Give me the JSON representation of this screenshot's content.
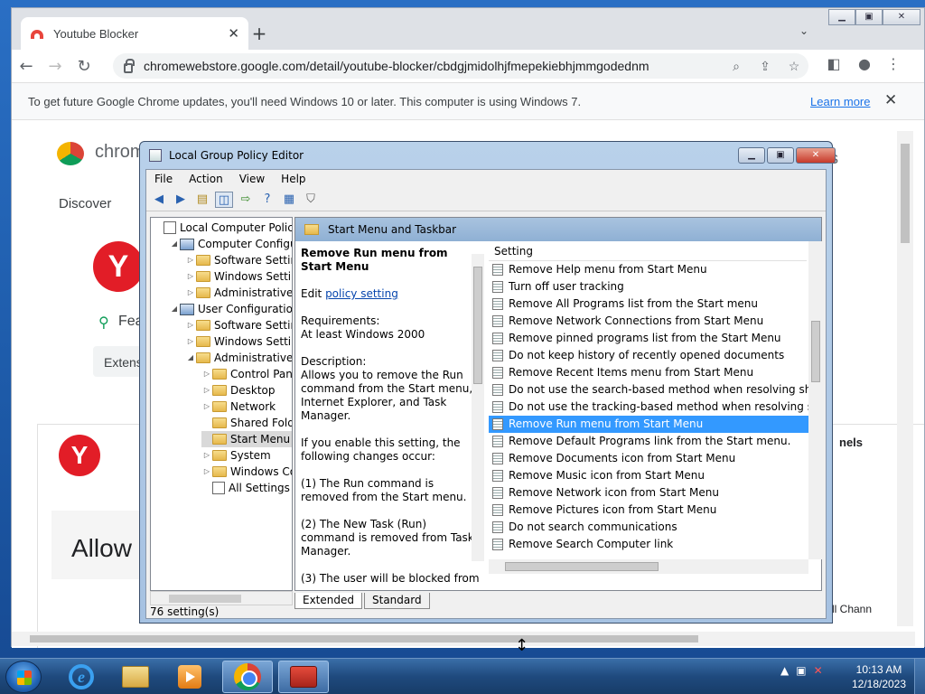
{
  "browser": {
    "tab_title": "Youtube Blocker",
    "url": "chromewebstore.google.com/detail/youtube-blocker/cbdgjmidolhjfmepekiebhjmmgodednm",
    "infobar_text": "To get future Google Chrome updates, you'll need Windows 10 or later. This computer is using Windows 7.",
    "infobar_link": "Learn more"
  },
  "background_page": {
    "brand": "chrom",
    "discover": "Discover",
    "feat": "Fea",
    "extens": "Extens",
    "allow": "Allow",
    "channels": "nels",
    "all_chann": "All Chann",
    "s_right": "s"
  },
  "gpedit": {
    "title": "Local Group Policy Editor",
    "menu": [
      "File",
      "Action",
      "View",
      "Help"
    ],
    "tree": [
      {
        "label": "Local Computer Policy",
        "indent": 0,
        "exp": "",
        "icon": "pol"
      },
      {
        "label": "Computer Configura",
        "indent": 1,
        "exp": "◢",
        "icon": "comp"
      },
      {
        "label": "Software Settings",
        "indent": 2,
        "exp": "▷",
        "icon": "fold"
      },
      {
        "label": "Windows Setting",
        "indent": 2,
        "exp": "▷",
        "icon": "fold"
      },
      {
        "label": "Administrative Te",
        "indent": 2,
        "exp": "▷",
        "icon": "fold"
      },
      {
        "label": "User Configuration",
        "indent": 1,
        "exp": "◢",
        "icon": "comp"
      },
      {
        "label": "Software Settings",
        "indent": 2,
        "exp": "▷",
        "icon": "fold"
      },
      {
        "label": "Windows Setting",
        "indent": 2,
        "exp": "▷",
        "icon": "fold"
      },
      {
        "label": "Administrative Te",
        "indent": 2,
        "exp": "◢",
        "icon": "fold"
      },
      {
        "label": "Control Panel",
        "indent": 3,
        "exp": "▷",
        "icon": "fold"
      },
      {
        "label": "Desktop",
        "indent": 3,
        "exp": "▷",
        "icon": "fold"
      },
      {
        "label": "Network",
        "indent": 3,
        "exp": "▷",
        "icon": "fold"
      },
      {
        "label": "Shared Folder",
        "indent": 3,
        "exp": "",
        "icon": "fold"
      },
      {
        "label": "Start Menu ar",
        "indent": 3,
        "exp": "",
        "icon": "fold",
        "selected": true
      },
      {
        "label": "System",
        "indent": 3,
        "exp": "▷",
        "icon": "fold"
      },
      {
        "label": "Windows Cor",
        "indent": 3,
        "exp": "▷",
        "icon": "fold"
      },
      {
        "label": "All Settings",
        "indent": 3,
        "exp": "",
        "icon": "pol"
      }
    ],
    "pane_header": "Start Menu and Taskbar",
    "desc": {
      "title": "Remove Run menu from Start Menu",
      "edit_prefix": "Edit ",
      "edit_link": "policy setting",
      "req_label": "Requirements:",
      "req_value": "At least Windows 2000",
      "desc_label": "Description:",
      "desc_text": "Allows you to remove the Run command from the Start menu, Internet Explorer, and Task Manager.",
      "enable_text": "If you enable this setting, the following changes occur:",
      "change1": "(1) The Run command is removed from the Start menu.",
      "change2": "(2) The New Task (Run) command is removed from Task Manager.",
      "change3": "(3) The user will be blocked from"
    },
    "column_header": "Setting",
    "settings": [
      "Remove Help menu from Start Menu",
      "Turn off user tracking",
      "Remove All Programs list from the Start menu",
      "Remove Network Connections from Start Menu",
      "Remove pinned programs list from the Start Menu",
      "Do not keep history of recently opened documents",
      "Remove Recent Items menu from Start Menu",
      "Do not use the search-based method when resolving shell s...",
      "Do not use the tracking-based method when resolving shell ...",
      "Remove Run menu from Start Menu",
      "Remove Default Programs link from the Start menu.",
      "Remove Documents icon from Start Menu",
      "Remove Music icon from Start Menu",
      "Remove Network icon from Start Menu",
      "Remove Pictures icon from Start Menu",
      "Do not search communications",
      "Remove Search Computer link"
    ],
    "selected_index": 9,
    "tabs": [
      "Extended",
      "Standard"
    ],
    "status": "76 setting(s)"
  },
  "taskbar": {
    "time": "10:13 AM",
    "date": "12/18/2023"
  }
}
